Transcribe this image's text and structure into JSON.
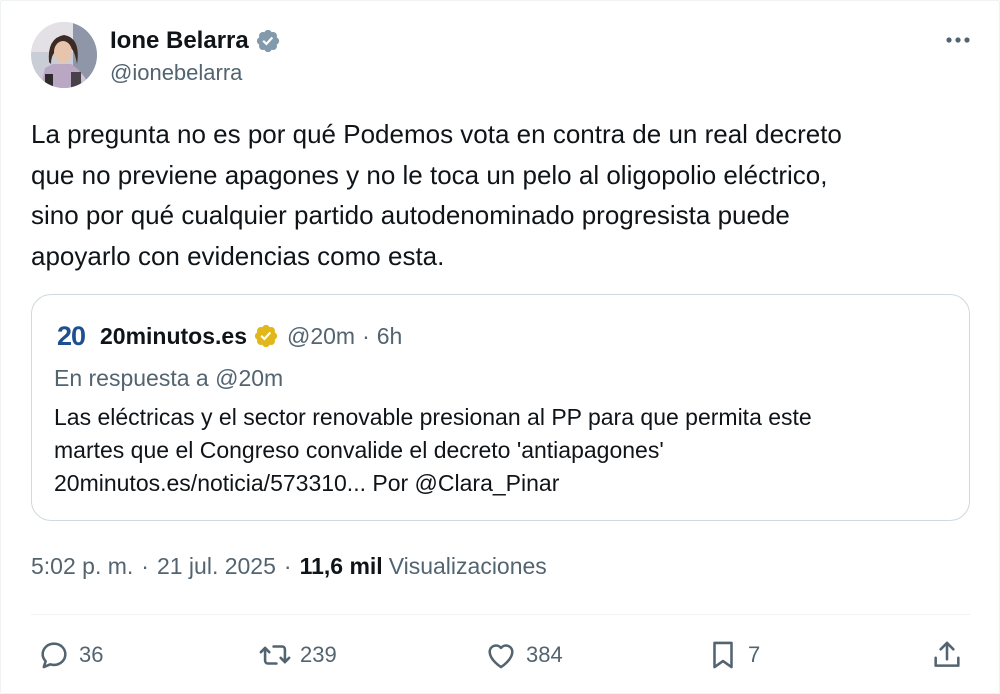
{
  "author": {
    "name": "Ione Belarra",
    "handle": "@ionebelarra",
    "verified_icon": "verified-badge-icon"
  },
  "more_icon": "more-options-icon",
  "tweet": {
    "lines": [
      "La pregunta no es por qué Podemos vota en contra de un real decreto",
      "que no previene apagones y no le toca un pelo al oligopolio eléctrico,",
      "sino por qué cualquier partido autodenominado progresista puede",
      "apoyarlo con evidencias como esta."
    ]
  },
  "quote": {
    "logo_text": "20",
    "name": "20minutos.es",
    "badge_icon": "gold-verified-badge-icon",
    "handle": "@20m",
    "separator": "·",
    "time": "6h",
    "reply_to": "En respuesta a @20m",
    "body": [
      "Las eléctricas y el sector renovable presionan al PP para que permita este",
      "martes que el Congreso convalide el decreto 'antiapagones'",
      "20minutos.es/noticia/573310... Por @Clara_Pinar"
    ]
  },
  "meta": {
    "time": "5:02 p. m.",
    "separator1": "·",
    "date": "21 jul. 2025",
    "separator2": "·",
    "views_count": "11,6 mil",
    "views_label": "Visualizaciones"
  },
  "actions": {
    "reply_count": "36",
    "retweet_count": "239",
    "like_count": "384",
    "bookmark_count": "7"
  },
  "colors": {
    "text": "#0f1419",
    "secondary": "#536471",
    "verified_blue": "#1d9bf0",
    "gold": "#e2b719",
    "border": "#cfd9de",
    "brand_20minutos": "#1d4f91"
  }
}
